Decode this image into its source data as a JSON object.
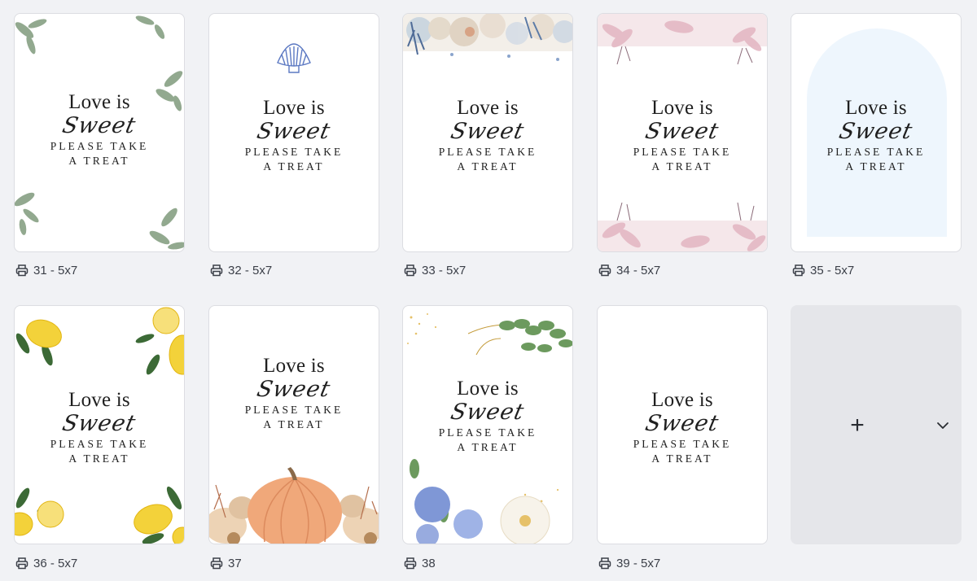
{
  "sign": {
    "line1": "Love is",
    "line2": "Sweet",
    "line3": "PLEASE TAKE",
    "line4": "A TREAT"
  },
  "pages": [
    {
      "caption": "31 - 5x7",
      "theme": "greenery",
      "icon": "print-icon"
    },
    {
      "caption": "32 - 5x7",
      "theme": "seashell",
      "icon": "print-icon"
    },
    {
      "caption": "33 - 5x7",
      "theme": "coral-reef",
      "icon": "print-icon"
    },
    {
      "caption": "34 - 5x7",
      "theme": "pink-lilies",
      "icon": "print-icon"
    },
    {
      "caption": "35 - 5x7",
      "theme": "blue-arch",
      "icon": "print-icon"
    },
    {
      "caption": "36 - 5x7",
      "theme": "lemons",
      "icon": "print-icon"
    },
    {
      "caption": "37",
      "theme": "pumpkin",
      "icon": "print-icon"
    },
    {
      "caption": "38",
      "theme": "blue-flowers-gold",
      "icon": "print-icon"
    },
    {
      "caption": "39 - 5x7",
      "theme": "plain",
      "icon": "print-icon"
    }
  ],
  "add_page": {
    "icon": "plus-icon",
    "menu_icon": "chevron-down-icon"
  },
  "colors": {
    "background": "#f1f2f5",
    "card": "#ffffff",
    "text": "#1f1f1f",
    "arch": "#eef6fd",
    "add_card": "#e5e6ea"
  }
}
